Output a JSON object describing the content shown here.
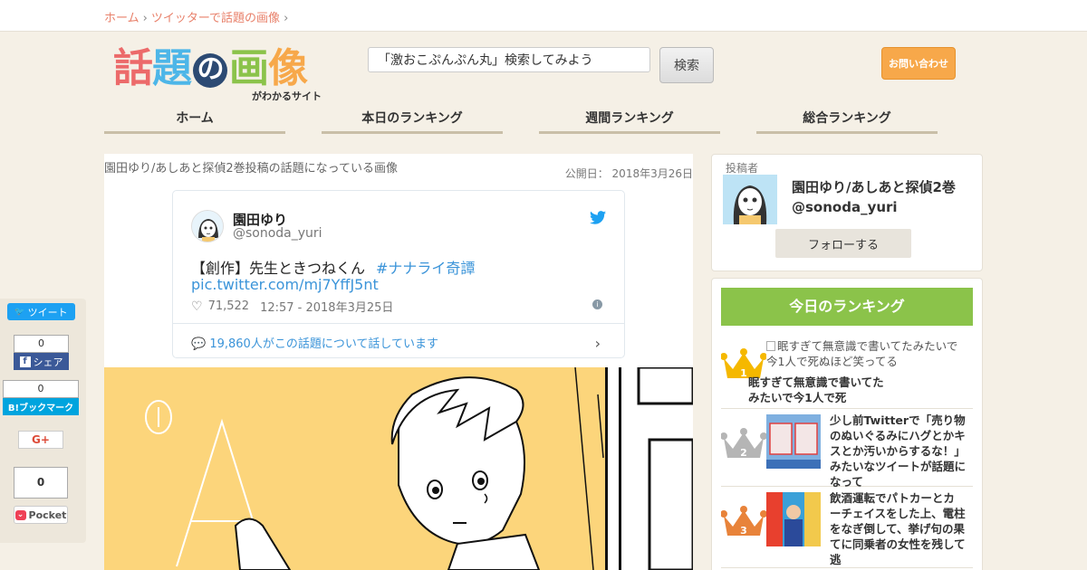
{
  "breadcrumb": {
    "home": "ホーム",
    "sep": "›",
    "category": "ツイッターで話題の画像",
    "sep2": "›"
  },
  "logo": {
    "chars": [
      "話",
      "題",
      "の",
      "画",
      "像"
    ],
    "colors": [
      "#ec6a6a",
      "#4db6e8",
      "#2c4a73",
      "#8bc34a",
      "#f7a84a"
    ],
    "subtitle": "がわかるサイト"
  },
  "search": {
    "value": "「激おこぷんぷん丸」検索してみよう",
    "button": "検索"
  },
  "contact": {
    "label": "お問い合わせ"
  },
  "nav": {
    "items": [
      "ホーム",
      "本日のランキング",
      "週間ランキング",
      "総合ランキング"
    ]
  },
  "post": {
    "title": "園田ゆり/あしあと探偵2巻投稿の話題になっている画像",
    "publish_label": "公開日：",
    "publish_date": "2018年3月26日"
  },
  "tweet": {
    "name": "園田ゆり",
    "handle": "@sonoda_yuri",
    "text": "【創作】先生ときつねくん",
    "hashtag": "#ナナライ奇譚",
    "link": "pic.twitter.com/mj7YffJ5nt",
    "likes": "71,522",
    "time": "12:57 - 2018年3月25日",
    "footer": "19,860人がこの話題について話しています"
  },
  "author": {
    "label": "投稿者",
    "name": "園田ゆり/あしあと探偵2巻",
    "handle": "@sonoda_yuri",
    "follow": "フォローする"
  },
  "ranking": {
    "header": "今日のランキング",
    "items": [
      {
        "rank": "1",
        "alt": "眠すぎて無意識で書いてたみたいで今1人で死ぬほど笑ってる",
        "title": "眠すぎて無意識で書いてたみたいで今1人で死"
      },
      {
        "rank": "2",
        "title": "少し前Twitterで「売り物のぬいぐるみにハグとかキスとか汚いからするな！」みたいなツイートが話題になって"
      },
      {
        "rank": "3",
        "title": "飲酒運転でパトカーとカーチェイスをした上、電柱をなぎ倒して、挙げ句の果てに同乗者の女性を残して逃"
      }
    ]
  },
  "social": {
    "tweet": "ツイート",
    "fb_count": "0",
    "fb_label": "シェア",
    "hatena_count": "0",
    "hatena_label": "B!ブックマーク",
    "gplus": "G+",
    "pocket_count": "0",
    "pocket_label": "Pocket"
  }
}
